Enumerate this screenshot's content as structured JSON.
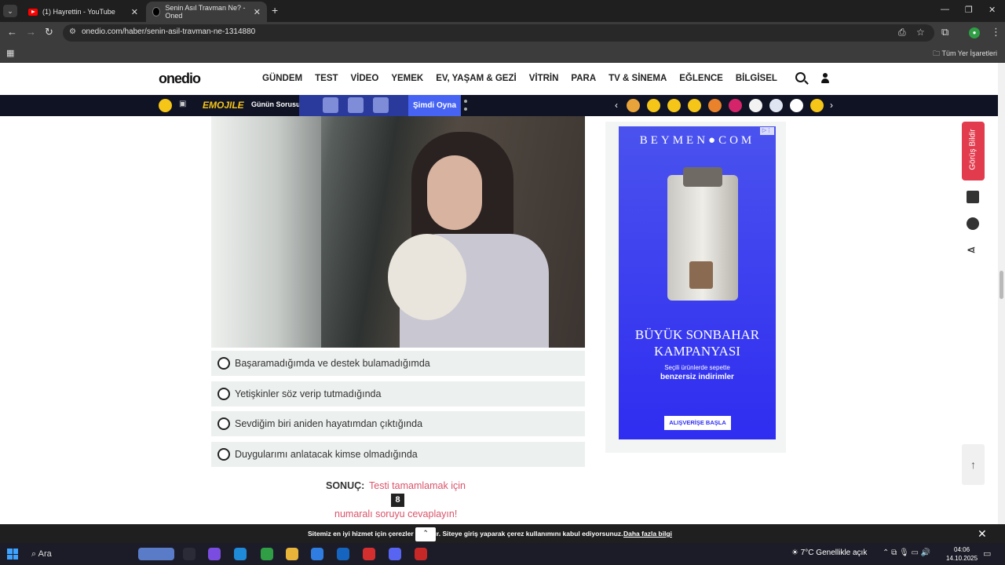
{
  "browser": {
    "tabs": [
      {
        "title": "(1) Hayrettin - YouTube"
      },
      {
        "title": "Senin Asıl Travman Ne? - Oned"
      }
    ],
    "url": "onedio.com/haber/senin-asil-travman-ne-1314880",
    "bookmarks_all": "Tüm Yer İşaretleri"
  },
  "site": {
    "logo": "onedio",
    "nav": [
      "GÜNDEM",
      "TEST",
      "VİDEO",
      "YEMEK",
      "EV, YAŞAM & GEZİ",
      "VİTRİN",
      "PARA",
      "TV & SİNEMA",
      "EĞLENCE",
      "BİLGİSEL"
    ]
  },
  "gamebar": {
    "game_name": "EMOJILE",
    "gunun_sorusu": "Günün Sorusu",
    "play": "Şimdi Oyna"
  },
  "quiz": {
    "options": [
      "Başaramadığımda ve destek bulamadığımda",
      "Yetişkinler söz verip tutmadığında",
      "Sevdiğim biri aniden hayatımdan çıktığında",
      "Duygularımı anlatacak kimse olmadığında"
    ],
    "result_label": "SONUÇ:",
    "result_text_top": "Testi tamamlamak için",
    "question_number": "8",
    "result_text_bottom": "numaralı soruyu cevaplayın!"
  },
  "ad": {
    "brand": "BEYMEN●COM",
    "headline": "BÜYÜK SONBAHAR KAMPANYASI",
    "sub1": "Seçili ürünlerde sepette",
    "sub2": "benzersiz indirimler",
    "cta": "ALIŞVERİŞE BAŞLA"
  },
  "sidebar": {
    "feedback": "Görüş Bildir"
  },
  "cookie": {
    "text": "Sitemiz en iyi hizmet için çerezler kullanır. Siteye giriş yaparak çerez kullanımını kabul ediyorsunuz.",
    "link": "Daha fazla bilgi"
  },
  "taskbar": {
    "search": "Ara",
    "weather": "7°C  Genellikle açık",
    "time": "04:06",
    "date": "14.10.2025"
  }
}
